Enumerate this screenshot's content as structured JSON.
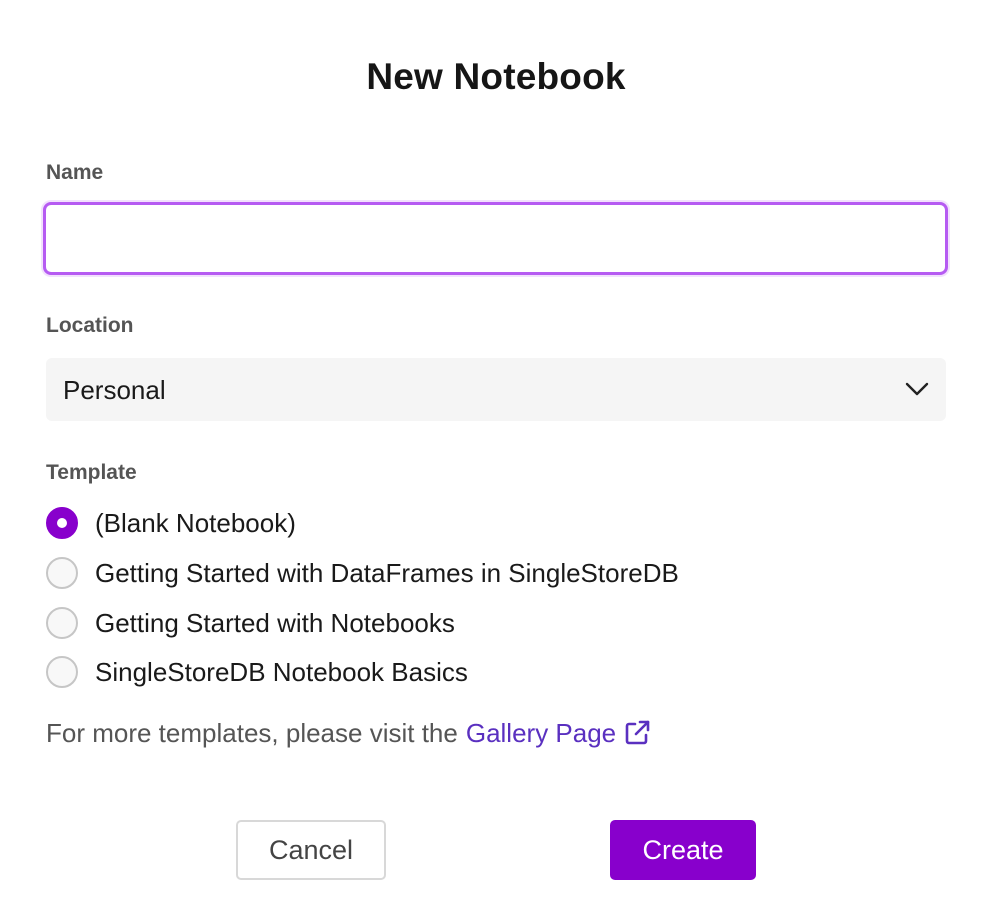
{
  "dialog": {
    "title": "New Notebook"
  },
  "name_field": {
    "label": "Name",
    "value": "",
    "placeholder": ""
  },
  "location_field": {
    "label": "Location",
    "selected": "Personal",
    "icon": "chevron-down-icon"
  },
  "template_field": {
    "label": "Template",
    "options": [
      {
        "label": "(Blank Notebook)",
        "checked": true
      },
      {
        "label": "Getting Started with DataFrames in SingleStoreDB",
        "checked": false
      },
      {
        "label": "Getting Started with Notebooks",
        "checked": false
      },
      {
        "label": "SingleStoreDB Notebook Basics",
        "checked": false
      }
    ]
  },
  "gallery": {
    "prefix_text": "For more templates, please visit the",
    "link_text": "Gallery Page",
    "icon": "external-link-icon"
  },
  "actions": {
    "cancel_label": "Cancel",
    "create_label": "Create"
  },
  "colors": {
    "accent": "#8800cc",
    "focus_border": "#b65bf2",
    "link": "#5a30c0"
  }
}
